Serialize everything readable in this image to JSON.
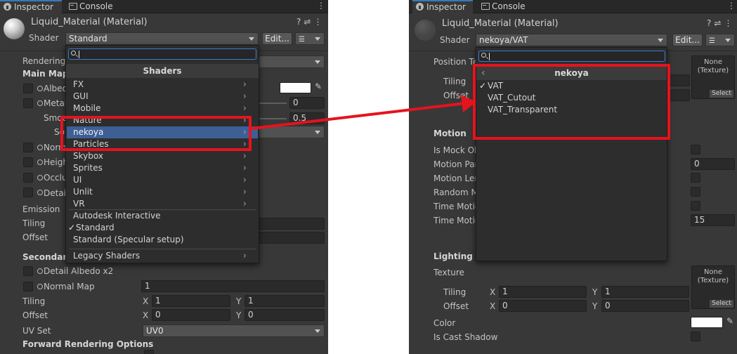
{
  "tabs": {
    "inspector": "Inspector",
    "console": "Console"
  },
  "colors": {
    "panel_bg": "#383838",
    "selection": "#3e5f96",
    "highlight_box": "#e5131e",
    "search_border": "#3d7ad0"
  },
  "left": {
    "material_title": "Liquid_Material (Material)",
    "shader_label": "Shader",
    "shader_value": "Standard",
    "edit_button": "Edit...",
    "rendering_label": "Rendering",
    "main_maps": "Main Maps",
    "albedo": "Albedo",
    "metallic": "Metallic",
    "smoothness": "Smoothness",
    "source": "Source",
    "metallic_value": "0",
    "smoothness_value": "0.5",
    "normal": "Normal Map",
    "height": "Height Map",
    "occlusion": "Occlusion",
    "detail": "Detail Mask",
    "emission": "Emission",
    "tiling": "Tiling",
    "offset": "Offset",
    "secondary_maps": "Secondary Maps",
    "detail_albedo": "Detail Albedo x2",
    "normal_map": "Normal Map",
    "normal_map_value": "1",
    "tiling2": "Tiling",
    "offset2": "Offset",
    "x_label": "X",
    "y_label": "Y",
    "tiling2_x": "1",
    "tiling2_y": "1",
    "offset2_x": "0",
    "offset2_y": "0",
    "uv_set": "UV Set",
    "uv_set_value": "UV0",
    "forward_options": "Forward Rendering Options",
    "popup": {
      "title": "Shaders",
      "items": [
        {
          "label": "FX",
          "submenu": true
        },
        {
          "label": "GUI",
          "submenu": true
        },
        {
          "label": "Mobile",
          "submenu": true
        },
        {
          "label": "Nature",
          "submenu": true
        },
        {
          "label": "nekoya",
          "submenu": true,
          "selected": true
        },
        {
          "label": "Particles",
          "submenu": true
        },
        {
          "label": "Skybox",
          "submenu": true
        },
        {
          "label": "Sprites",
          "submenu": true
        },
        {
          "label": "UI",
          "submenu": true
        },
        {
          "label": "Unlit",
          "submenu": true
        },
        {
          "label": "VR",
          "submenu": true
        },
        {
          "label": "Autodesk Interactive",
          "submenu": false
        },
        {
          "label": "Standard",
          "submenu": false,
          "checked": true
        },
        {
          "label": "Standard (Specular setup)",
          "submenu": false
        }
      ],
      "legacy": "Legacy Shaders"
    }
  },
  "right": {
    "material_title": "Liquid_Material (Material)",
    "shader_label": "Shader",
    "shader_value": "nekoya/VAT",
    "edit_button": "Edit...",
    "position_tex": "Position Texture",
    "tiling": "Tiling",
    "offset": "Offset",
    "tex_none": "None",
    "tex_type": "(Texture)",
    "tex_select": "Select",
    "motion_header": "Motion",
    "is_mock": "Is Mock Object",
    "motion_param": "Motion Parameter",
    "motion_param_value": "0",
    "motion_length": "Motion Length",
    "random_motion": "Random Motion",
    "time_motion1": "Time Motion",
    "time_motion2": "Time Motion",
    "time_motion2_value": "15",
    "lighting_header": "Lighting",
    "texture": "Texture",
    "tiling_l": "Tiling",
    "offset_l": "Offset",
    "x_label": "X",
    "y_label": "Y",
    "tiling_x": "1",
    "tiling_y": "1",
    "offset_x": "0",
    "offset_y": "0",
    "color": "Color",
    "is_cast_shadow": "Is Cast Shadow",
    "popup": {
      "back": "‹",
      "title": "nekoya",
      "items": [
        {
          "label": "VAT",
          "checked": true
        },
        {
          "label": "VAT_Cutout",
          "checked": false
        },
        {
          "label": "VAT_Transparent",
          "checked": false
        }
      ]
    }
  },
  "icons": {
    "help": "?",
    "settings": "⇌",
    "more": "⋮",
    "check": "✓",
    "submenu": "›",
    "picker": "⁄"
  }
}
